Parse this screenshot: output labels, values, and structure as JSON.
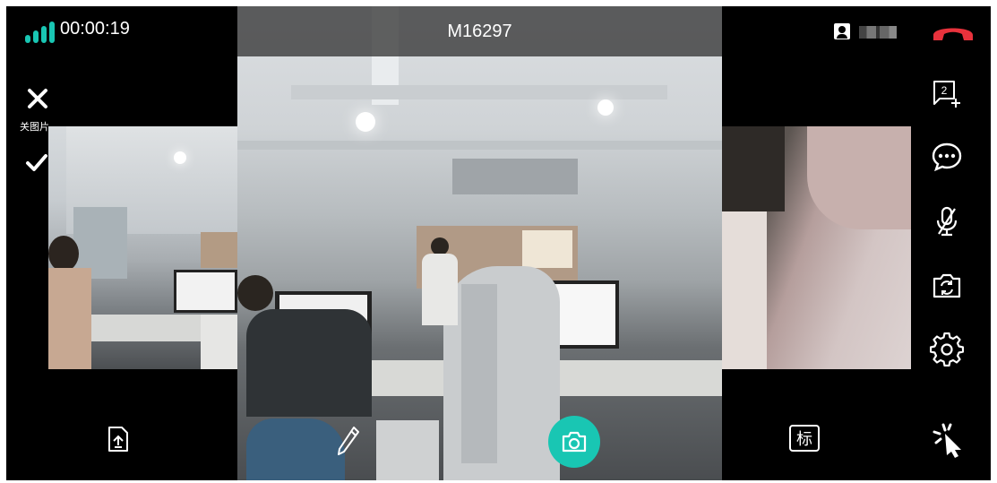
{
  "call": {
    "timer": "00:00:19",
    "room_id": "M16297",
    "signal_level": 4
  },
  "left_panel": {
    "close_label": "关图片"
  },
  "bottom_bar": {
    "mark_label": "标"
  },
  "icons": {
    "signal": "signal-bars-icon",
    "participant": "participant-icon",
    "hangup": "hang-up-icon",
    "close": "close-icon",
    "confirm": "checkmark-icon",
    "add_participant": "add-participant-icon",
    "chat": "chat-bubble-icon",
    "mute": "microphone-off-icon",
    "switch_camera": "switch-camera-icon",
    "settings": "gear-icon",
    "upload_doc": "document-upload-icon",
    "annotate": "pencil-icon",
    "capture": "camera-capture-icon",
    "pointer": "click-pointer-icon"
  },
  "colors": {
    "accent": "#19c6b3",
    "hangup": "#e8323c",
    "background": "#000000"
  },
  "add_participant_badge": "2"
}
